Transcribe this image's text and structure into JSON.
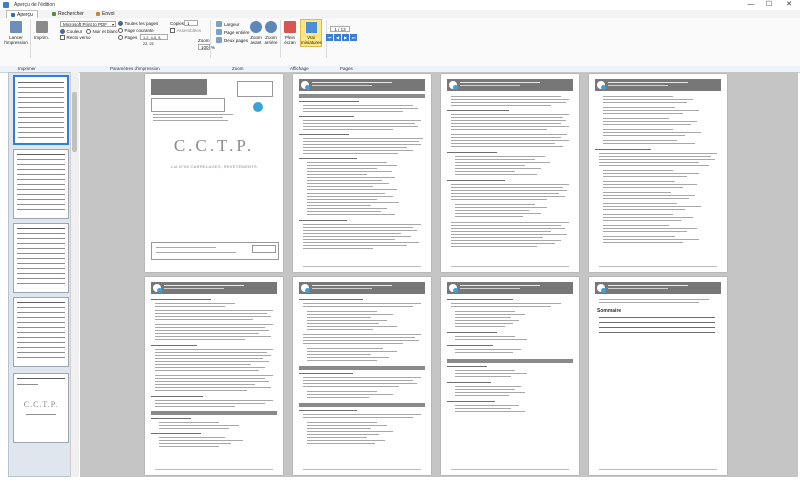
{
  "window": {
    "title": "Aperçu de l'édition",
    "minimize_glyph": "—",
    "maximize_glyph": "☐",
    "close_glyph": "✕"
  },
  "tabs": [
    {
      "label": "Aperçu",
      "active": true
    },
    {
      "label": "Rechercher",
      "active": false
    },
    {
      "label": "Envoi",
      "active": false
    }
  ],
  "ribbon": {
    "print_label": "Lancer l'impression",
    "printer_label": "Imprim.",
    "printer_value": "Microsoft Print to PDF",
    "color_label": "Couleur",
    "bw_label": "Noir et blanc",
    "duplex_label": "Recto verso",
    "all_pages_label": "Toutes les pages",
    "current_page_label": "Page courante",
    "pages_label": "Pages",
    "pages_value": "1-2, 4-5, 5, 22, 25",
    "copies_label": "Copies",
    "copies_value": "1",
    "collate_label": "Assemblées",
    "width_label": "Largeur",
    "page_whole_label": "Page entière",
    "two_pages_label": "Deux pages",
    "zoom_label": "Zoom",
    "zoom_value": "100",
    "zoom_percent": "%",
    "zoom_in_label": "Zoom avant",
    "zoom_out_label": "Zoom arrière",
    "full_screen_label": "Plein écran",
    "true_size_label": "Vrai miniatures",
    "page_counter": "1 / 13",
    "nav_first": "⏮",
    "nav_prev": "◀",
    "nav_next": "▶",
    "nav_last": "⏭"
  },
  "section_bar": {
    "print_section": "Imprimer",
    "params_section": "Paramètres d'impression",
    "zoom_section": "Zoom",
    "display_section": "Affichage",
    "pages_section": "Pages"
  },
  "document": {
    "cover_title": "C.C.T.P.",
    "cover_subtitle": "Lot N°06 CARRELAGES, REVETEMENTS",
    "thumb_cover_title": "C.C.T.P.",
    "summary_heading": "Sommaire"
  },
  "colors": {
    "accent": "#2f7fd6",
    "header_gray": "#777777",
    "highlight_yellow": "#ffe680",
    "viewer_bg": "#c5c5c5"
  }
}
